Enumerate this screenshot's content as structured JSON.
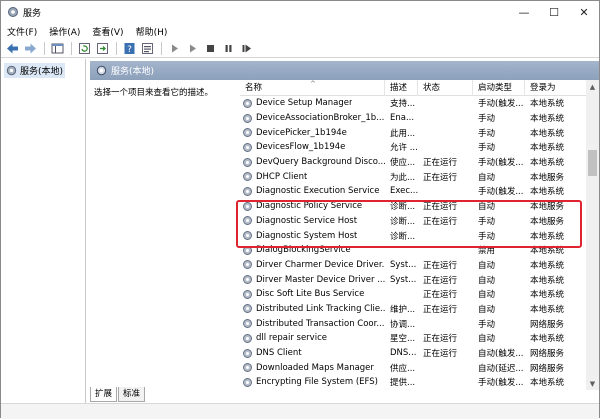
{
  "window": {
    "title": "服务"
  },
  "menu": [
    "文件(F)",
    "操作(A)",
    "查看(V)",
    "帮助(H)"
  ],
  "tree": {
    "root_label": "服务(本地)"
  },
  "content": {
    "header_title": "服务(本地)",
    "description_prompt": "选择一个项目来查看它的描述。"
  },
  "columns": {
    "name": "名称",
    "desc": "描述",
    "status": "状态",
    "startup": "启动类型",
    "logon": "登录为"
  },
  "services": [
    {
      "name": "Device Setup Manager",
      "desc": "支持...",
      "status": "",
      "startup": "手动(触发...",
      "logon": "本地系统"
    },
    {
      "name": "DeviceAssociationBroker_1b...",
      "desc": "Ena...",
      "status": "",
      "startup": "手动",
      "logon": "本地系统"
    },
    {
      "name": "DevicePicker_1b194e",
      "desc": "此用...",
      "status": "",
      "startup": "手动",
      "logon": "本地系统"
    },
    {
      "name": "DevicesFlow_1b194e",
      "desc": "允许 ...",
      "status": "",
      "startup": "手动",
      "logon": "本地系统"
    },
    {
      "name": "DevQuery Background Disco...",
      "desc": "使应...",
      "status": "正在运行",
      "startup": "手动(触发...",
      "logon": "本地系统"
    },
    {
      "name": "DHCP Client",
      "desc": "为此...",
      "status": "正在运行",
      "startup": "自动",
      "logon": "本地服务"
    },
    {
      "name": "Diagnostic Execution Service",
      "desc": "Exec...",
      "status": "",
      "startup": "手动(触发...",
      "logon": "本地系统"
    },
    {
      "name": "Diagnostic Policy Service",
      "desc": "诊断...",
      "status": "正在运行",
      "startup": "自动",
      "logon": "本地服务"
    },
    {
      "name": "Diagnostic Service Host",
      "desc": "诊断...",
      "status": "正在运行",
      "startup": "手动",
      "logon": "本地服务"
    },
    {
      "name": "Diagnostic System Host",
      "desc": "诊断...",
      "status": "",
      "startup": "手动",
      "logon": "本地系统"
    },
    {
      "name": "DialogBlockingService",
      "desc": "",
      "status": "",
      "startup": "禁用",
      "logon": "本地系统"
    },
    {
      "name": "Dirver Charmer Device Driver...",
      "desc": "Syst...",
      "status": "正在运行",
      "startup": "自动",
      "logon": "本地系统"
    },
    {
      "name": "Dirver Master Device Driver ...",
      "desc": "Syst...",
      "status": "正在运行",
      "startup": "自动",
      "logon": "本地系统"
    },
    {
      "name": "Disc Soft Lite Bus Service",
      "desc": "",
      "status": "正在运行",
      "startup": "自动",
      "logon": "本地系统"
    },
    {
      "name": "Distributed Link Tracking Clie...",
      "desc": "维护...",
      "status": "正在运行",
      "startup": "自动",
      "logon": "本地系统"
    },
    {
      "name": "Distributed Transaction Coor...",
      "desc": "协调...",
      "status": "",
      "startup": "手动",
      "logon": "网络服务"
    },
    {
      "name": "dll repair service",
      "desc": "星空...",
      "status": "正在运行",
      "startup": "自动",
      "logon": "本地系统"
    },
    {
      "name": "DNS Client",
      "desc": "DNS...",
      "status": "正在运行",
      "startup": "自动(触发...",
      "logon": "网络服务"
    },
    {
      "name": "Downloaded Maps Manager",
      "desc": "供应...",
      "status": "",
      "startup": "自动(延迟...",
      "logon": "网络服务"
    },
    {
      "name": "Encrypting File System (EFS)",
      "desc": "提供...",
      "status": "",
      "startup": "手动(触发...",
      "logon": "本地系统"
    }
  ],
  "tabs": [
    "扩展",
    "标准"
  ],
  "colors": {
    "highlight": "#e0242f",
    "header_bg": "#8ca0bb"
  }
}
